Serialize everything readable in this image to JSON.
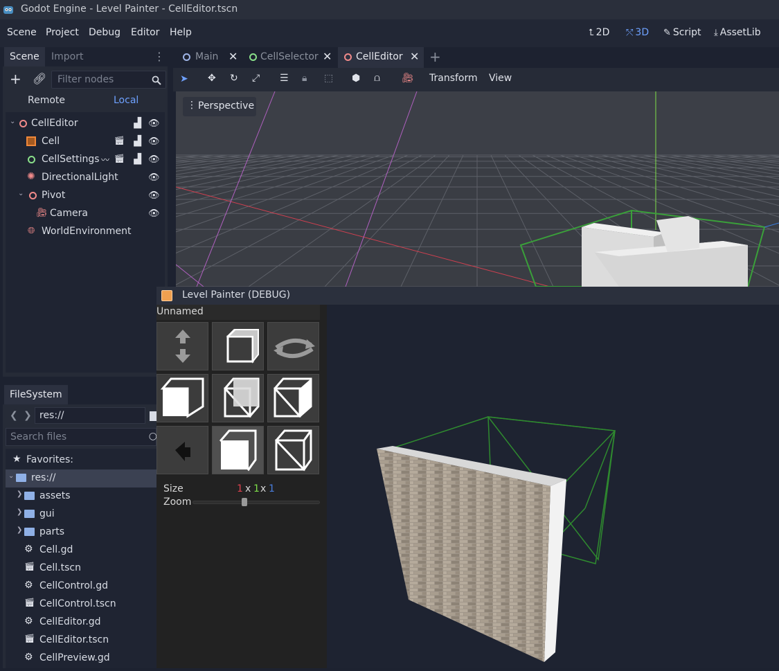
{
  "window": {
    "title": "Godot Engine - Level Painter - CellEditor.tscn"
  },
  "menu": [
    "Scene",
    "Project",
    "Debug",
    "Editor",
    "Help"
  ],
  "workspaces": [
    {
      "label": "2D",
      "icon": "2d-icon"
    },
    {
      "label": "3D",
      "icon": "3d-icon",
      "active": true
    },
    {
      "label": "Script",
      "icon": "script-icon"
    },
    {
      "label": "AssetLib",
      "icon": "assetlib-icon"
    }
  ],
  "scene_dock": {
    "tabs": [
      "Scene",
      "Import"
    ],
    "filter_placeholder": "Filter nodes",
    "remote": "Remote",
    "local": "Local",
    "tree": [
      {
        "name": "CellEditor",
        "icon": "node3d-icon",
        "depth": 0,
        "expanded": true
      },
      {
        "name": "Cell",
        "icon": "csg-icon",
        "depth": 1
      },
      {
        "name": "CellSettings",
        "icon": "node-icon",
        "depth": 1
      },
      {
        "name": "DirectionalLight",
        "icon": "light-icon",
        "depth": 1
      },
      {
        "name": "Pivot",
        "icon": "node3d-icon",
        "depth": 1,
        "expanded": true
      },
      {
        "name": "Camera",
        "icon": "camera-icon",
        "depth": 2
      },
      {
        "name": "WorldEnvironment",
        "icon": "world-icon",
        "depth": 1
      }
    ]
  },
  "filesystem": {
    "tab": "FileSystem",
    "path": "res://",
    "search_placeholder": "Search files",
    "favorites": "Favorites:",
    "root": "res://",
    "items": [
      {
        "name": "assets",
        "type": "folder"
      },
      {
        "name": "gui",
        "type": "folder"
      },
      {
        "name": "parts",
        "type": "folder"
      },
      {
        "name": "Cell.gd",
        "type": "script"
      },
      {
        "name": "Cell.tscn",
        "type": "scene"
      },
      {
        "name": "CellControl.gd",
        "type": "script"
      },
      {
        "name": "CellControl.tscn",
        "type": "scene"
      },
      {
        "name": "CellEditor.gd",
        "type": "script"
      },
      {
        "name": "CellEditor.tscn",
        "type": "scene"
      },
      {
        "name": "CellPreview.gd",
        "type": "script"
      }
    ]
  },
  "editor_tabs": [
    "Main",
    "CellSelector",
    "CellEditor"
  ],
  "toolbar": {
    "transform": "Transform",
    "view": "View"
  },
  "viewport": {
    "perspective": "Perspective"
  },
  "level_painter": {
    "title": "Level Painter (DEBUG)",
    "cell_name": "Unnamed",
    "size_label": "Size",
    "size": {
      "x": "1",
      "y": "1",
      "z": "1",
      "sep": "x"
    },
    "zoom_label": "Zoom",
    "zoom": 0.4
  },
  "colors": {
    "accent": "#6ea1ff",
    "x_axis": "#e0424f",
    "y_axis": "#7fe04a",
    "z_axis": "#4a7fe0",
    "node_pink": "#f08a8a",
    "node_green": "#8ae08a"
  }
}
